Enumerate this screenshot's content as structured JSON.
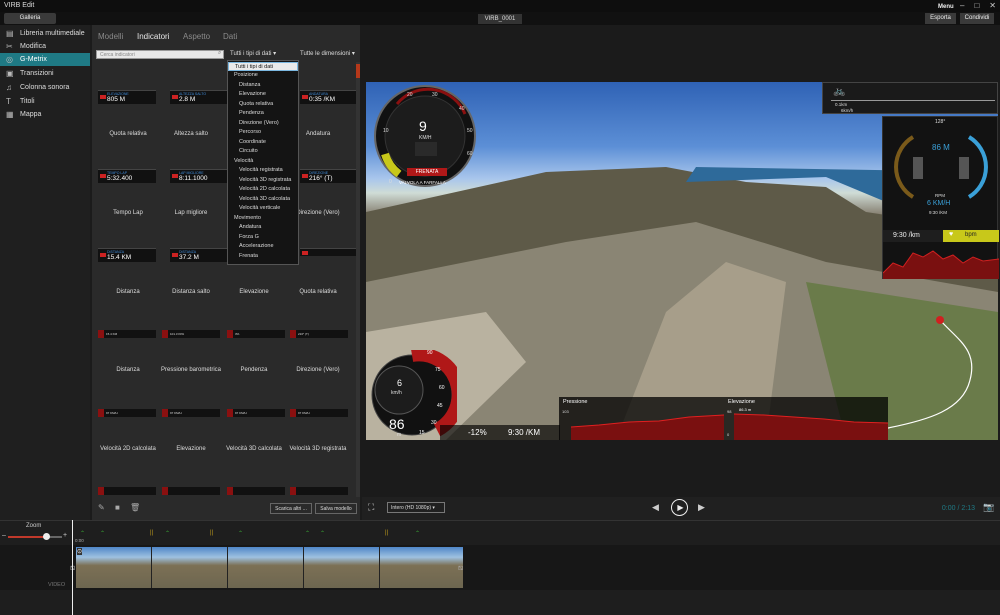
{
  "app": {
    "title": "VIRB Edit",
    "menu": "Menu",
    "export": "Esporta",
    "share": "Condividi",
    "gallery": "Galleria",
    "file_tab": "VIRB_0001"
  },
  "sidebar": {
    "items": [
      {
        "label": "Libreria multimediale",
        "icon": "library-icon"
      },
      {
        "label": "Modifica",
        "icon": "scissors-icon"
      },
      {
        "label": "G-Metrix",
        "icon": "gmetrix-icon",
        "active": true
      },
      {
        "label": "Transizioni",
        "icon": "transitions-icon"
      },
      {
        "label": "Colonna sonora",
        "icon": "music-icon"
      },
      {
        "label": "Titoli",
        "icon": "title-icon"
      },
      {
        "label": "Mappa",
        "icon": "map-icon"
      }
    ]
  },
  "panel": {
    "tabs": [
      "Modelli",
      "Indicatori",
      "Aspetto",
      "Dati"
    ],
    "active_tab": "Indicatori",
    "search_placeholder": "Cerca indicatori",
    "types_select": "Tutti i tipi di dati",
    "dims_select": "Tutte le dimensioni",
    "download_btn": "Scarica altri ...",
    "save_btn": "Salva modello"
  },
  "dropdown": {
    "items": [
      {
        "label": "Tutti i tipi di dati",
        "level": 0,
        "selected": true
      },
      {
        "label": "Posizione",
        "level": 0
      },
      {
        "label": "Distanza",
        "level": 1
      },
      {
        "label": "Elevazione",
        "level": 1
      },
      {
        "label": "Quota relativa",
        "level": 1
      },
      {
        "label": "Pendenza",
        "level": 1
      },
      {
        "label": "Direzione (Vero)",
        "level": 1
      },
      {
        "label": "Percorso",
        "level": 1
      },
      {
        "label": "Coordinate",
        "level": 1
      },
      {
        "label": "Circuito",
        "level": 1
      },
      {
        "label": "Velocità",
        "level": 0
      },
      {
        "label": "Velocità registrata",
        "level": 1
      },
      {
        "label": "Velocità 3D registrata",
        "level": 1
      },
      {
        "label": "Velocità 2D calcolata",
        "level": 1
      },
      {
        "label": "Velocità 3D calcolata",
        "level": 1
      },
      {
        "label": "Velocità verticale",
        "level": 1
      },
      {
        "label": "Movimento",
        "level": 0
      },
      {
        "label": "Andatura",
        "level": 1
      },
      {
        "label": "Forza G",
        "level": 1
      },
      {
        "label": "Accelerazione",
        "level": 1
      },
      {
        "label": "Frenata",
        "level": 1
      }
    ]
  },
  "gauges": {
    "row1": [
      {
        "label": "ELEVAZIONE",
        "value": "805 M",
        "name": "Quota relativa"
      },
      {
        "label": "ALTEZZA SALTO",
        "value": "2.8 M",
        "name": "Altezza salto"
      },
      {
        "label": "",
        "value": "",
        "name": ""
      },
      {
        "label": "ANDATURA",
        "value": "0:35 /KM",
        "name": "Andatura"
      }
    ],
    "row2": [
      {
        "label": "TEMPO LAP",
        "value": "5:32.400",
        "name": "Tempo Lap"
      },
      {
        "label": "LAP MIGLIORE",
        "value": "8:11.1000",
        "name": "Lap migliore"
      },
      {
        "label": "",
        "value": "",
        "name": ""
      },
      {
        "label": "DIREZIONE",
        "value": "216° (T)",
        "name": "Direzione (Vero)"
      }
    ],
    "row3": [
      {
        "label": "DISTANZA",
        "value": "15.4 KM",
        "name": "Distanza"
      },
      {
        "label": "DISTANZA",
        "value": "37.2 M",
        "name": "Distanza salto"
      },
      {
        "label": "",
        "value": "",
        "name": "Elevazione"
      },
      {
        "label": "",
        "value": "",
        "name": "Quota relativa"
      }
    ],
    "row4": [
      {
        "label": "15.4 KM",
        "name": "Distanza"
      },
      {
        "label": "101.3 KPA",
        "name": "Pressione barometrica"
      },
      {
        "label": "3%",
        "name": "Pendenza"
      },
      {
        "label": "216° (T)",
        "name": "Direzione (Vero)"
      }
    ],
    "row5": [
      {
        "label": "97 KM/H",
        "name": "Velocità 2D calcolata"
      },
      {
        "label": "97 KM/H",
        "name": "Elevazione"
      },
      {
        "label": "97 KM/H",
        "name": "Velocità 3D calcolata"
      },
      {
        "label": "97 KM/H",
        "name": "Velocità 3D registrata"
      }
    ]
  },
  "overlay": {
    "speed_value": "9",
    "speed_unit": "KM/H",
    "brake_label": "FRENATA",
    "brake_sub": "VALVOLA A FARFALLA",
    "scale_labels": [
      "10",
      "20",
      "30",
      "40",
      "50",
      "60",
      "0"
    ],
    "gear_value": "6",
    "gear_unit": "km/h",
    "rpm_value": "86",
    "rpm_unit": "m",
    "rpm_scale": [
      "90",
      "75",
      "60",
      "45",
      "30",
      "15"
    ],
    "pct": "-12%",
    "pace": "9:30 /KM",
    "pressure_label": "Pressione",
    "pressure_value": "101.1 kPa",
    "pressure_top": "103",
    "elev_label": "Elevazione",
    "elev_value": "86.3 m",
    "elev_top": "98",
    "elev_bottom": "0",
    "right_heading": "128°",
    "right_speed": "86 M",
    "right_rpm_lbl": "RPM",
    "right_speed2": "6 KM/H",
    "right_pace_small": "9:30 /KM",
    "right_pace": "9:30 /km",
    "right_hr": "bpm",
    "lap_dist": "0.1km",
    "lap_speed": "6km/h"
  },
  "controls": {
    "quality": "Intero (HD 1080p)",
    "time": "0:00 / 2:13"
  },
  "timeline": {
    "zoom": "Zoom",
    "video": "VIDEO",
    "start": "0:00"
  },
  "colors": {
    "accent": "#1f7a85",
    "red": "#c0392b"
  }
}
